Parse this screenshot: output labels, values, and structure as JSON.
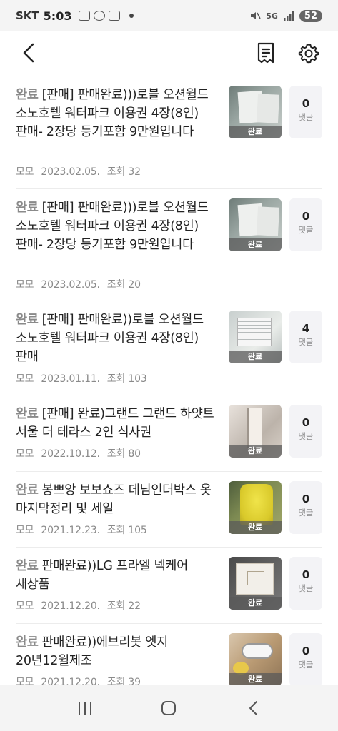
{
  "status_bar": {
    "carrier": "SKT",
    "time": "5:03",
    "network": "5G",
    "battery": "52"
  },
  "items": [
    {
      "status": "완료",
      "title": "[판매] 판매완료)))로블 오션월드 소노호텔 워터파크 이용권 4장(8인)판매- 2장당 등기포함 9만원입니다",
      "author": "모모",
      "date": "2023.02.05.",
      "views": "조회 32",
      "thumb_badge": "완료",
      "comment_count": "0",
      "comment_label": "댓글"
    },
    {
      "status": "완료",
      "title": "[판매] 판매완료)))로블 오션월드 소노호텔 워터파크 이용권 4장(8인)판매- 2장당 등기포함 9만원입니다",
      "author": "모모",
      "date": "2023.02.05.",
      "views": "조회 20",
      "thumb_badge": "완료",
      "comment_count": "0",
      "comment_label": "댓글"
    },
    {
      "status": "완료",
      "title": "[판매] 판매완료))로블 오션월드 소노호텔 워터파크 이용권 4장(8인)판매",
      "author": "모모",
      "date": "2023.01.11.",
      "views": "조회 103",
      "thumb_badge": "완료",
      "comment_count": "4",
      "comment_label": "댓글"
    },
    {
      "status": "완료",
      "title": "[판매] 완료)그랜드 그랜드 하얏트 서울 더 테라스 2인 식사권",
      "author": "모모",
      "date": "2022.10.12.",
      "views": "조회 80",
      "thumb_badge": "완료",
      "comment_count": "0",
      "comment_label": "댓글"
    },
    {
      "status": "완료",
      "title": "봉쁘앙 보보쇼즈 데님인더박스 옷 마지막정리 및 세일",
      "author": "모모",
      "date": "2021.12.23.",
      "views": "조회 105",
      "thumb_badge": "완료",
      "comment_count": "0",
      "comment_label": "댓글"
    },
    {
      "status": "완료",
      "title": "판매완료))LG 프라엘 넥케어 새상품",
      "author": "모모",
      "date": "2021.12.20.",
      "views": "조회 22",
      "thumb_badge": "완료",
      "comment_count": "0",
      "comment_label": "댓글"
    },
    {
      "status": "완료",
      "title": "판매완료))에브리봇 엣지 20년12월제조",
      "author": "모모",
      "date": "2021.12.20.",
      "views": "조회 39",
      "thumb_badge": "완료",
      "comment_count": "0",
      "comment_label": "댓글"
    }
  ],
  "icons": {
    "back": "back-arrow-icon",
    "memo": "memo-list-icon",
    "settings": "gear-icon",
    "nav_recents": "recents-icon",
    "nav_home": "home-icon",
    "nav_back": "nav-back-icon"
  }
}
